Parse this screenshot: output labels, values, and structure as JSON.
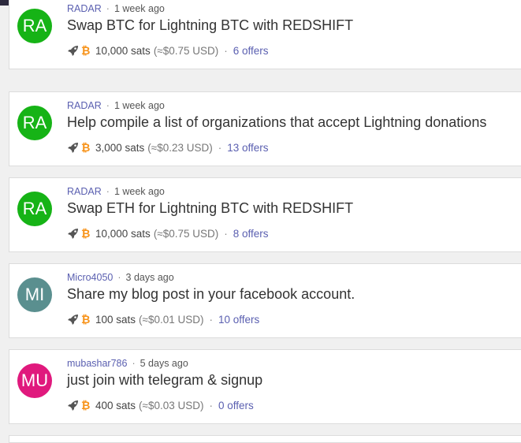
{
  "posts": [
    {
      "avatar_initials": "RA",
      "avatar_color": "#16b316",
      "user": "RADAR",
      "time": "1 week ago",
      "title": "Swap BTC for Lightning BTC with REDSHIFT",
      "sats": "10,000 sats",
      "usd": "(≈$0.75 USD)",
      "offers": "6 offers"
    },
    {
      "avatar_initials": "RA",
      "avatar_color": "#16b316",
      "user": "RADAR",
      "time": "1 week ago",
      "title": "Help compile a list of organizations that accept Lightning donations",
      "sats": "3,000 sats",
      "usd": "(≈$0.23 USD)",
      "offers": "13 offers"
    },
    {
      "avatar_initials": "RA",
      "avatar_color": "#16b316",
      "user": "RADAR",
      "time": "1 week ago",
      "title": "Swap ETH for Lightning BTC with REDSHIFT",
      "sats": "10,000 sats",
      "usd": "(≈$0.75 USD)",
      "offers": "8 offers"
    },
    {
      "avatar_initials": "MI",
      "avatar_color": "#5a8f8f",
      "user": "Micro4050",
      "time": "3 days ago",
      "title": "Share my blog post in your facebook account.",
      "sats": "100 sats",
      "usd": "(≈$0.01 USD)",
      "offers": "10 offers"
    },
    {
      "avatar_initials": "MU",
      "avatar_color": "#e0197d",
      "user": "mubashar786",
      "time": "5 days ago",
      "title": "just join with telegram & signup",
      "sats": "400 sats",
      "usd": "(≈$0.03 USD)",
      "offers": "0 offers"
    }
  ],
  "separator": "·",
  "icons": {
    "rocket": "rocket-icon",
    "bitcoin": "bitcoin-icon",
    "bitcoin_glyph": "₿"
  }
}
